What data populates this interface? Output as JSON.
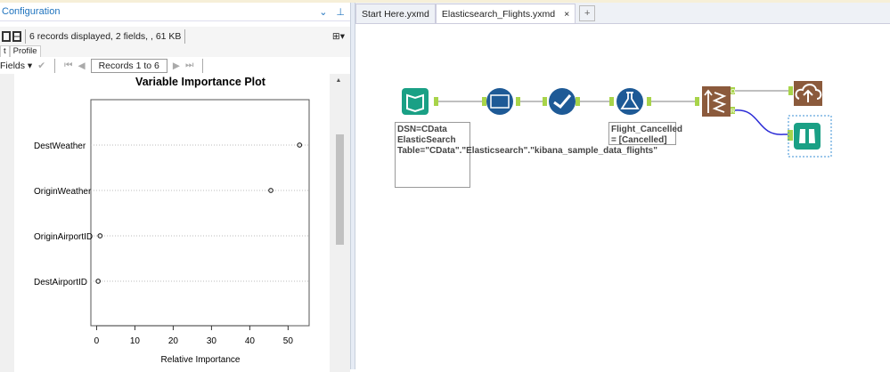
{
  "config_panel": {
    "title": "Configuration",
    "chevron": "⌄",
    "pin": "📌",
    "status": "6 records displayed, 2 fields, , 61 KB",
    "tabs": [
      "t",
      "Profile"
    ],
    "fields_label": "Fields",
    "records_label": "Records 1 to 6"
  },
  "workflow": {
    "tabs": [
      {
        "label": "Start Here.yxmd"
      },
      {
        "label": "Elasticsearch_Flights.yxmd",
        "close": "×"
      }
    ],
    "new_tab": "+",
    "annotations": {
      "input": "DSN=CData ElasticSearch Table=\"CData\".\"Elasticsearch\".\"kibana_sample_data_flights\"",
      "formula": "Flight_Cancelled = [Cancelled]"
    },
    "anchors": {
      "o": "O",
      "r": "R"
    },
    "colors": {
      "green": "#1aa085",
      "blue": "#1e5a96",
      "brown": "#8b5a3c",
      "connector": "#a8d44a",
      "wire_selected": "#2b2bd6"
    }
  },
  "chart_data": {
    "type": "scatter",
    "title": "Variable Importance Plot",
    "xlabel": "Relative Importance",
    "ylabel": "",
    "categories": [
      "DestWeather",
      "OriginWeather",
      "OriginAirportID",
      "DestAirportID"
    ],
    "values": [
      53.0,
      45.5,
      0.9,
      0.4
    ],
    "xlim": [
      -1.5,
      55.5
    ],
    "xticks": [
      0,
      10,
      20,
      30,
      40,
      50
    ],
    "grid": "dotted horizontal"
  }
}
